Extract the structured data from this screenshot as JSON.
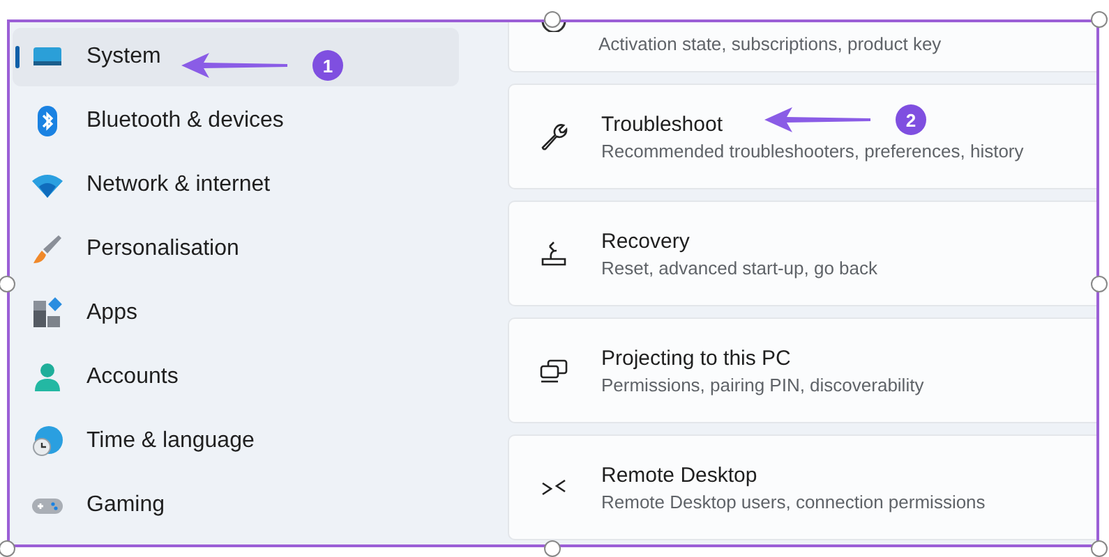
{
  "sidebar": {
    "items": [
      {
        "label": "System",
        "selected": true
      },
      {
        "label": "Bluetooth & devices",
        "selected": false
      },
      {
        "label": "Network & internet",
        "selected": false
      },
      {
        "label": "Personalisation",
        "selected": false
      },
      {
        "label": "Apps",
        "selected": false
      },
      {
        "label": "Accounts",
        "selected": false
      },
      {
        "label": "Time & language",
        "selected": false
      },
      {
        "label": "Gaming",
        "selected": false
      }
    ]
  },
  "settings": [
    {
      "kind": "partial",
      "subtitle": "Activation state, subscriptions, product key"
    },
    {
      "kind": "full",
      "title": "Troubleshoot",
      "subtitle": "Recommended troubleshooters, preferences, history"
    },
    {
      "kind": "full",
      "title": "Recovery",
      "subtitle": "Reset, advanced start-up, go back"
    },
    {
      "kind": "full",
      "title": "Projecting to this PC",
      "subtitle": "Permissions, pairing PIN, discoverability"
    },
    {
      "kind": "full",
      "title": "Remote Desktop",
      "subtitle": "Remote Desktop users, connection permissions"
    }
  ],
  "annotations": [
    {
      "label": "1"
    },
    {
      "label": "2"
    }
  ]
}
